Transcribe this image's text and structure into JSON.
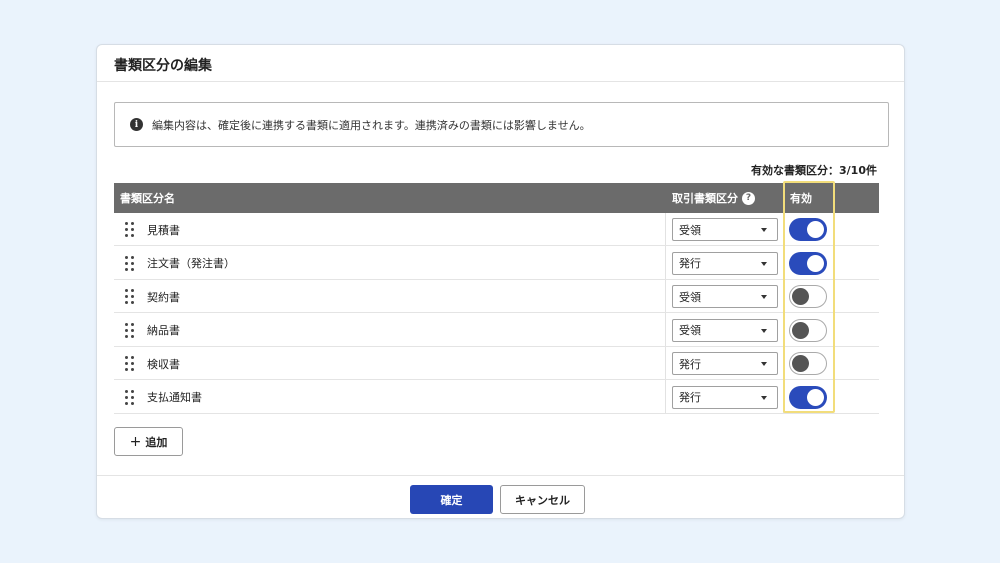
{
  "dialog": {
    "title": "書類区分の編集",
    "info_text": "編集内容は、確定後に連携する書類に適用されます。連携済みの書類には影響しません。",
    "count_text": "有効な書類区分：3/10件"
  },
  "table": {
    "headers": {
      "name": "書類区分名",
      "type": "取引書類区分",
      "help": "?",
      "active": "有効"
    },
    "rows": [
      {
        "name": "見積書",
        "type": "受領",
        "active": true
      },
      {
        "name": "注文書（発注書）",
        "type": "発行",
        "active": true
      },
      {
        "name": "契約書",
        "type": "受領",
        "active": false
      },
      {
        "name": "納品書",
        "type": "受領",
        "active": false
      },
      {
        "name": "検収書",
        "type": "発行",
        "active": false
      },
      {
        "name": "支払通知書",
        "type": "発行",
        "active": true
      }
    ]
  },
  "buttons": {
    "add_plus": "+",
    "add_label": "追加",
    "confirm": "確定",
    "cancel": "キャンセル"
  },
  "icons": {
    "info": "i",
    "info_icon_name": "info-icon",
    "drag_icon_name": "drag-handle-icon"
  },
  "colors": {
    "primary": "#2747b5",
    "toggle_on": "#2a4bbb",
    "header_bg": "#6b6b6b",
    "highlight": "#f2dd7b",
    "background": "#eaf3fc"
  }
}
